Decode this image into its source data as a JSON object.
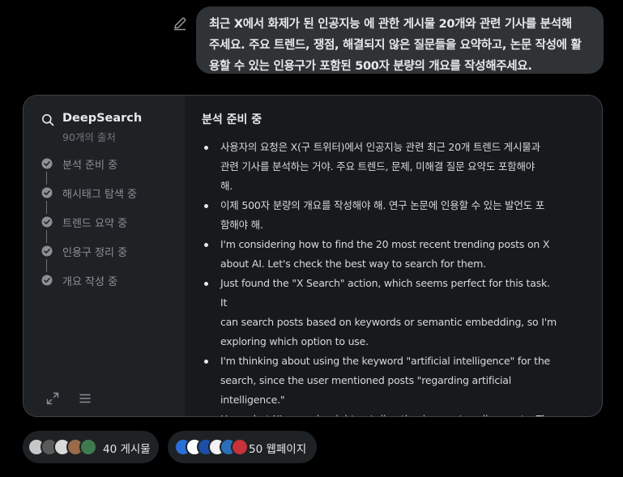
{
  "user_message": {
    "lines": [
      "최근 X에서 화제가 된  인공지능 에 관한 게시물 20개와 관련 기사를 분석해",
      "주세요. 주요 트렌드, 쟁점, 해결되지 않은 질문들을 요약하고, 논문 작성에 활",
      "용할 수 있는 인용구가 포함된 500자 분량의 개요를 작성해주세요."
    ]
  },
  "deepsearch": {
    "title": "DeepSearch",
    "subtitle": "90개의 출처",
    "steps": [
      {
        "label": "분석 준비 중"
      },
      {
        "label": "해시태그 탐색 중"
      },
      {
        "label": "트렌드 요약 중"
      },
      {
        "label": "인용구 정리 중"
      },
      {
        "label": "개요 작성 중"
      }
    ]
  },
  "content": {
    "heading": "분석 준비 중",
    "bullets": [
      {
        "lines": [
          "사용자의 요청은 X(구 트위터)에서 인공지능 관련 최근 20개 트렌드 게시물과",
          "관련 기사를 분석하는 거야. 주요 트렌드, 문제, 미해결 질문 요약도 포함해야",
          "해."
        ]
      },
      {
        "lines": [
          "이제 500자 분량의 개요를 작성해야 해. 연구 논문에 인용할 수 있는 발언도 포",
          "함해야 해."
        ]
      },
      {
        "lines": [
          "I'm considering how to find the 20 most recent trending posts on X",
          "about AI. Let's check the best way to search for them."
        ]
      },
      {
        "lines": [
          "Just found the \"X Search\" action, which seems perfect for this task. It",
          "can search posts based on keywords or semantic embedding, so I'm",
          "exploring which option to use."
        ]
      },
      {
        "lines": [
          "I'm thinking about using the keyword \"artificial intelligence\" for the",
          "search, since the user mentioned posts \"regarding artificial",
          "intelligence.\""
        ]
      },
      {
        "lines": [
          "Hmm, but X's search might not directly give me trending posts. The"
        ]
      }
    ]
  },
  "sources": {
    "posts_label": "40 게시물",
    "web_label": "50 웹페이지"
  },
  "colors": {
    "background": "#000000",
    "bubble": "#2f3336",
    "panel": "#17191c",
    "sidebar": "#1f2225",
    "text": "#e7e9ea",
    "muted": "#71767b"
  }
}
